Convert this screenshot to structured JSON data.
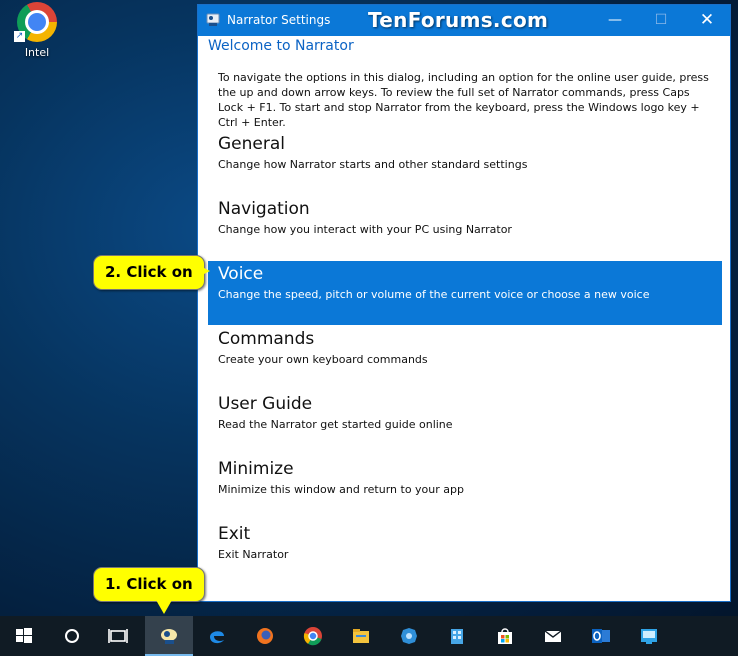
{
  "desktop": {
    "shortcut_label": "Intel"
  },
  "window": {
    "title": "Narrator Settings",
    "watermark": "TenForums.com",
    "heading": "Welcome to Narrator",
    "intro": "To navigate the options in this dialog, including an option for the online user guide, press the up and down arrow keys. To review the full set of Narrator commands, press Caps Lock + F1. To start and stop Narrator from the keyboard, press the Windows logo key + Ctrl + Enter.",
    "items": [
      {
        "title": "General",
        "desc": "Change how Narrator starts and other standard settings"
      },
      {
        "title": "Navigation",
        "desc": "Change how you interact with your PC using Narrator"
      },
      {
        "title": "Voice",
        "desc": "Change the speed, pitch or volume of the current voice or choose a new voice"
      },
      {
        "title": "Commands",
        "desc": "Create your own keyboard commands"
      },
      {
        "title": "User Guide",
        "desc": "Read the Narrator get started guide online"
      },
      {
        "title": "Minimize",
        "desc": "Minimize this window and return to your app"
      },
      {
        "title": "Exit",
        "desc": "Exit Narrator"
      }
    ],
    "selected_item": "Voice"
  },
  "callouts": {
    "step1": "1. Click on",
    "step2": "2. Click on"
  },
  "taskbar": {
    "items": [
      "start",
      "cortana-search",
      "task-view",
      "narrator",
      "edge",
      "firefox",
      "chrome",
      "file-explorer",
      "app-blue",
      "app-building",
      "store",
      "mail",
      "outlook",
      "app-screen"
    ],
    "active_item": "narrator"
  },
  "colors": {
    "accent": "#0b78d7",
    "callout": "#ffff00",
    "taskbar": "#101b24",
    "heading": "#0b63c4"
  }
}
